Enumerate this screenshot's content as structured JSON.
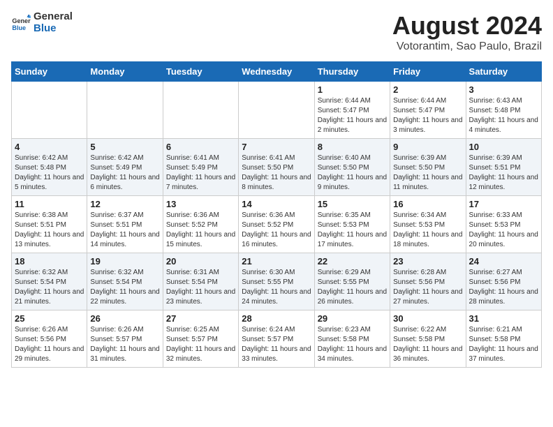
{
  "header": {
    "logo": {
      "line1": "General",
      "line2": "Blue"
    },
    "title": "August 2024",
    "subtitle": "Votorantim, Sao Paulo, Brazil"
  },
  "weekdays": [
    "Sunday",
    "Monday",
    "Tuesday",
    "Wednesday",
    "Thursday",
    "Friday",
    "Saturday"
  ],
  "weeks": [
    [
      {
        "day": "",
        "info": ""
      },
      {
        "day": "",
        "info": ""
      },
      {
        "day": "",
        "info": ""
      },
      {
        "day": "",
        "info": ""
      },
      {
        "day": "1",
        "info": "Sunrise: 6:44 AM\nSunset: 5:47 PM\nDaylight: 11 hours and 2 minutes."
      },
      {
        "day": "2",
        "info": "Sunrise: 6:44 AM\nSunset: 5:47 PM\nDaylight: 11 hours and 3 minutes."
      },
      {
        "day": "3",
        "info": "Sunrise: 6:43 AM\nSunset: 5:48 PM\nDaylight: 11 hours and 4 minutes."
      }
    ],
    [
      {
        "day": "4",
        "info": "Sunrise: 6:42 AM\nSunset: 5:48 PM\nDaylight: 11 hours and 5 minutes."
      },
      {
        "day": "5",
        "info": "Sunrise: 6:42 AM\nSunset: 5:49 PM\nDaylight: 11 hours and 6 minutes."
      },
      {
        "day": "6",
        "info": "Sunrise: 6:41 AM\nSunset: 5:49 PM\nDaylight: 11 hours and 7 minutes."
      },
      {
        "day": "7",
        "info": "Sunrise: 6:41 AM\nSunset: 5:50 PM\nDaylight: 11 hours and 8 minutes."
      },
      {
        "day": "8",
        "info": "Sunrise: 6:40 AM\nSunset: 5:50 PM\nDaylight: 11 hours and 9 minutes."
      },
      {
        "day": "9",
        "info": "Sunrise: 6:39 AM\nSunset: 5:50 PM\nDaylight: 11 hours and 11 minutes."
      },
      {
        "day": "10",
        "info": "Sunrise: 6:39 AM\nSunset: 5:51 PM\nDaylight: 11 hours and 12 minutes."
      }
    ],
    [
      {
        "day": "11",
        "info": "Sunrise: 6:38 AM\nSunset: 5:51 PM\nDaylight: 11 hours and 13 minutes."
      },
      {
        "day": "12",
        "info": "Sunrise: 6:37 AM\nSunset: 5:51 PM\nDaylight: 11 hours and 14 minutes."
      },
      {
        "day": "13",
        "info": "Sunrise: 6:36 AM\nSunset: 5:52 PM\nDaylight: 11 hours and 15 minutes."
      },
      {
        "day": "14",
        "info": "Sunrise: 6:36 AM\nSunset: 5:52 PM\nDaylight: 11 hours and 16 minutes."
      },
      {
        "day": "15",
        "info": "Sunrise: 6:35 AM\nSunset: 5:53 PM\nDaylight: 11 hours and 17 minutes."
      },
      {
        "day": "16",
        "info": "Sunrise: 6:34 AM\nSunset: 5:53 PM\nDaylight: 11 hours and 18 minutes."
      },
      {
        "day": "17",
        "info": "Sunrise: 6:33 AM\nSunset: 5:53 PM\nDaylight: 11 hours and 20 minutes."
      }
    ],
    [
      {
        "day": "18",
        "info": "Sunrise: 6:32 AM\nSunset: 5:54 PM\nDaylight: 11 hours and 21 minutes."
      },
      {
        "day": "19",
        "info": "Sunrise: 6:32 AM\nSunset: 5:54 PM\nDaylight: 11 hours and 22 minutes."
      },
      {
        "day": "20",
        "info": "Sunrise: 6:31 AM\nSunset: 5:54 PM\nDaylight: 11 hours and 23 minutes."
      },
      {
        "day": "21",
        "info": "Sunrise: 6:30 AM\nSunset: 5:55 PM\nDaylight: 11 hours and 24 minutes."
      },
      {
        "day": "22",
        "info": "Sunrise: 6:29 AM\nSunset: 5:55 PM\nDaylight: 11 hours and 26 minutes."
      },
      {
        "day": "23",
        "info": "Sunrise: 6:28 AM\nSunset: 5:56 PM\nDaylight: 11 hours and 27 minutes."
      },
      {
        "day": "24",
        "info": "Sunrise: 6:27 AM\nSunset: 5:56 PM\nDaylight: 11 hours and 28 minutes."
      }
    ],
    [
      {
        "day": "25",
        "info": "Sunrise: 6:26 AM\nSunset: 5:56 PM\nDaylight: 11 hours and 29 minutes."
      },
      {
        "day": "26",
        "info": "Sunrise: 6:26 AM\nSunset: 5:57 PM\nDaylight: 11 hours and 31 minutes."
      },
      {
        "day": "27",
        "info": "Sunrise: 6:25 AM\nSunset: 5:57 PM\nDaylight: 11 hours and 32 minutes."
      },
      {
        "day": "28",
        "info": "Sunrise: 6:24 AM\nSunset: 5:57 PM\nDaylight: 11 hours and 33 minutes."
      },
      {
        "day": "29",
        "info": "Sunrise: 6:23 AM\nSunset: 5:58 PM\nDaylight: 11 hours and 34 minutes."
      },
      {
        "day": "30",
        "info": "Sunrise: 6:22 AM\nSunset: 5:58 PM\nDaylight: 11 hours and 36 minutes."
      },
      {
        "day": "31",
        "info": "Sunrise: 6:21 AM\nSunset: 5:58 PM\nDaylight: 11 hours and 37 minutes."
      }
    ]
  ]
}
